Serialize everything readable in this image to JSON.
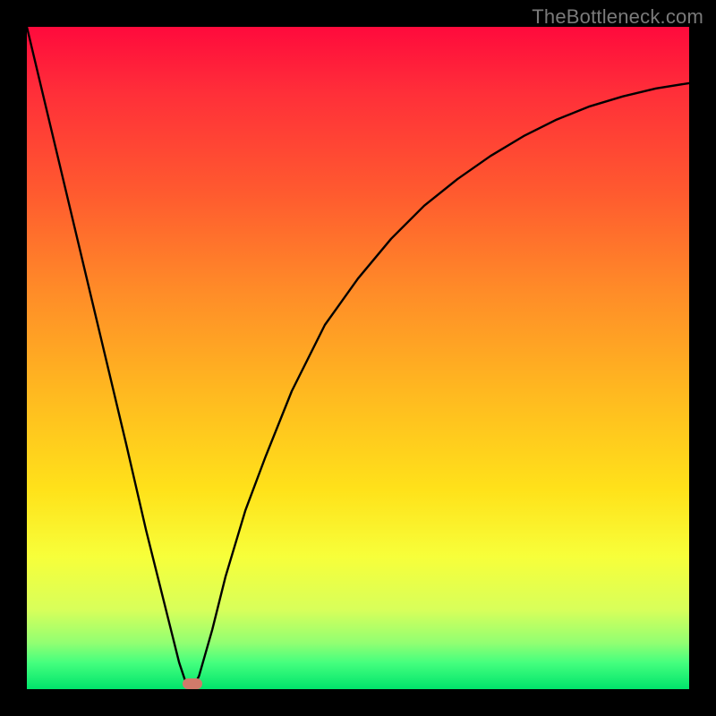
{
  "watermark": "TheBottleneck.com",
  "chart_data": {
    "type": "line",
    "title": "",
    "xlabel": "",
    "ylabel": "",
    "xlim": [
      0,
      100
    ],
    "ylim": [
      0,
      100
    ],
    "series": [
      {
        "name": "curve",
        "x": [
          0,
          5,
          10,
          15,
          18,
          20,
          21.5,
          23,
          24,
          25,
          26,
          28,
          30,
          33,
          36,
          40,
          45,
          50,
          55,
          60,
          65,
          70,
          75,
          80,
          85,
          90,
          95,
          100
        ],
        "values": [
          100,
          79,
          58,
          37,
          24,
          16,
          10,
          4,
          1,
          0,
          2,
          9,
          17,
          27,
          35,
          45,
          55,
          62,
          68,
          73,
          77,
          80.5,
          83.5,
          86,
          88,
          89.5,
          90.7,
          91.5
        ]
      }
    ],
    "marker": {
      "x": 25,
      "y": 0.8
    },
    "gradient_stops": [
      {
        "pct": 0,
        "color": "#ff0a3c"
      },
      {
        "pct": 50,
        "color": "#ffb820"
      },
      {
        "pct": 80,
        "color": "#f7ff3a"
      },
      {
        "pct": 100,
        "color": "#00e46b"
      }
    ]
  }
}
